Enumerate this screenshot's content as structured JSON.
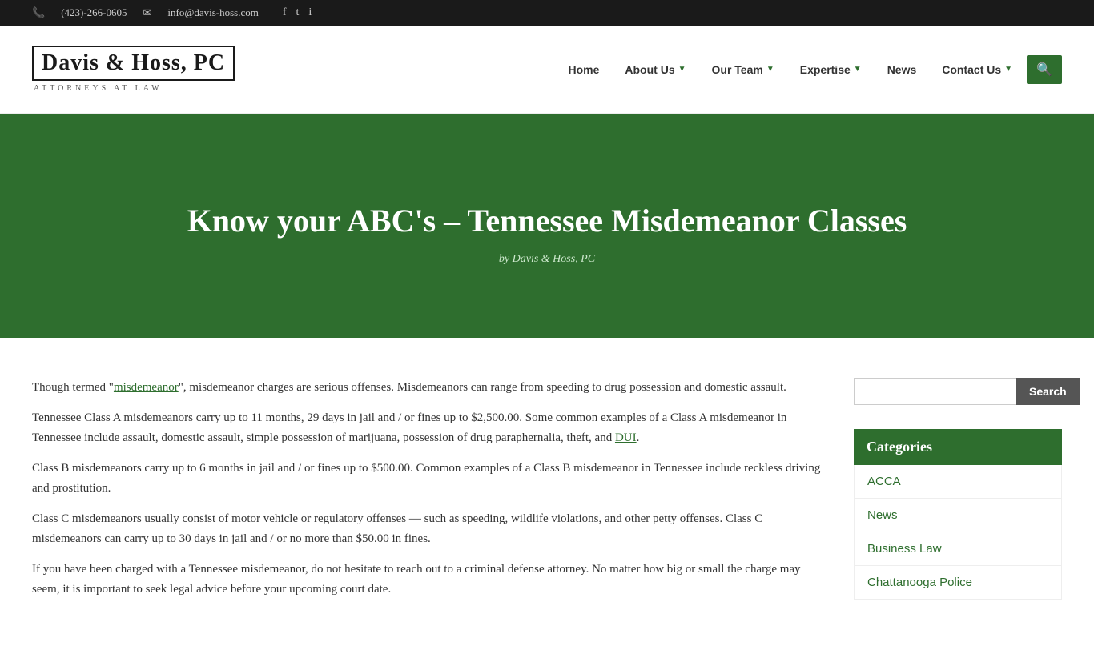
{
  "topbar": {
    "phone": "(423)-266-0605",
    "email": "info@davis-hoss.com",
    "phone_icon": "📞",
    "email_icon": "✉",
    "social": [
      "f",
      "t",
      "📷"
    ]
  },
  "logo": {
    "name": "Davis & Hoss, PC",
    "subtitle": "ATTORNEYS AT LAW"
  },
  "nav": {
    "items": [
      {
        "label": "Home",
        "has_arrow": false
      },
      {
        "label": "About Us",
        "has_arrow": true
      },
      {
        "label": "Our Team",
        "has_arrow": true
      },
      {
        "label": "Expertise",
        "has_arrow": true
      },
      {
        "label": "News",
        "has_arrow": false
      },
      {
        "label": "Contact Us",
        "has_arrow": true
      }
    ],
    "search_icon": "🔍"
  },
  "hero": {
    "title": "Know your ABC's – Tennessee Misdemeanor Classes",
    "author": "by Davis & Hoss, PC"
  },
  "content": {
    "paragraphs": [
      "Though termed \"misdemeanor\", misdemeanor charges are serious offenses. Misdemeanors can range from speeding to drug possession and domestic assault.",
      "Tennessee Class A misdemeanors carry up to 11 months, 29 days in jail and / or fines up to $2,500.00. Some common examples of a Class A misdemeanor in Tennessee include assault, domestic assault, simple possession of marijuana, possession of drug paraphernalia, theft, and DUI.",
      "Class B misdemeanors carry up to 6 months in jail and / or fines up to $500.00. Common examples of a Class B misdemeanor in Tennessee include reckless driving and prostitution.",
      "Class C misdemeanors usually consist of motor vehicle or regulatory offenses — such as speeding, wildlife violations, and other petty offenses. Class C misdemeanors can carry up to 30 days in jail and / or no more than $50.00 in fines.",
      "If you have been charged with a Tennessee misdemeanor, do not hesitate to reach out to a criminal defense attorney. No matter how big or small the charge may seem, it is important to seek legal advice before your upcoming court date."
    ],
    "dui_link": "DUI"
  },
  "sidebar": {
    "search_placeholder": "",
    "search_button_label": "Search",
    "categories_header": "Categories",
    "categories": [
      "ACCA",
      "News",
      "Business Law",
      "Chattanooga Police"
    ]
  }
}
